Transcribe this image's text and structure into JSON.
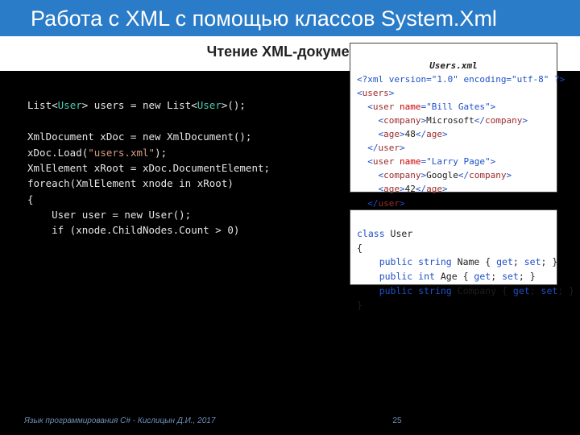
{
  "title": "Работа с XML с помощью классов System.Xml",
  "subtitle": "Чтение XML-документа",
  "code_left": {
    "l1a": "List<",
    "l1type": "User",
    "l1b": "> users = new List<",
    "l1c": ">();",
    "l2": " ",
    "l3": "XmlDocument xDoc = new XmlDocument();",
    "l4a": "xDoc.Load(",
    "l4str": "\"users.xml\"",
    "l4b": ");",
    "l5": "XmlElement xRoot = xDoc.DocumentElement;",
    "l6": "foreach(XmlElement xnode in xRoot)",
    "l7": "{",
    "l8": "    User user = new User();",
    "l9": "    if (xnode.ChildNodes.Count > 0)"
  },
  "xml": {
    "header": "Users.xml",
    "pi_open": "<?",
    "pi_body": "xml version=\"1.0\" encoding=\"utf-8\" ",
    "pi_close": "?>",
    "users_open_a": "<",
    "users_name": "users",
    "users_open_b": ">",
    "user1_open_a": "  <",
    "user1_name": "user",
    "user1_sp": " ",
    "user1_attr": "name",
    "user1_eq": "=",
    "user1_val": "\"Bill Gates\"",
    "user1_open_b": ">",
    "comp1_a": "    <",
    "comp1_n": "company",
    "comp1_b": ">",
    "comp1_txt": "Microsoft",
    "comp1_c": "</",
    "comp1_d": ">",
    "age1_a": "    <",
    "age1_n": "age",
    "age1_b": ">",
    "age1_txt": "48",
    "age1_c": "</",
    "age1_d": ">",
    "user1_close_a": "  </",
    "user1_close_b": ">",
    "user2_open_a": "  <",
    "user2_name": "user",
    "user2_sp": " ",
    "user2_attr": "name",
    "user2_eq": "=",
    "user2_val": "\"Larry Page\"",
    "user2_open_b": ">",
    "comp2_a": "    <",
    "comp2_n": "company",
    "comp2_b": ">",
    "comp2_txt": "Google",
    "comp2_c": "</",
    "comp2_d": ">",
    "age2_a": "    <",
    "age2_n": "age",
    "age2_b": ">",
    "age2_txt": "42",
    "age2_c": "</",
    "age2_d": ">",
    "user2_close_a": "  </",
    "user2_close_b": ">",
    "users_close_a": "</",
    "users_close_b": ">"
  },
  "klass": {
    "l1a": "class",
    "l1b": " User",
    "l2": "{",
    "l3a": "    public",
    "l3b": " string",
    "l3c": " Name { ",
    "l3d": "get",
    "l3e": "; ",
    "l3f": "set",
    "l3g": "; }",
    "l4a": "    public",
    "l4b": " int",
    "l4c": " Age { ",
    "l4d": "get",
    "l4e": "; ",
    "l4f": "set",
    "l4g": "; }",
    "l5a": "    public",
    "l5b": " string",
    "l5c": " Company { ",
    "l5d": "get",
    "l5e": "; ",
    "l5f": "set",
    "l5g": "; }",
    "l6": "}"
  },
  "footer": {
    "credit": "Язык программирования C# - Кислицын Д.И., 2017",
    "page": "25"
  }
}
